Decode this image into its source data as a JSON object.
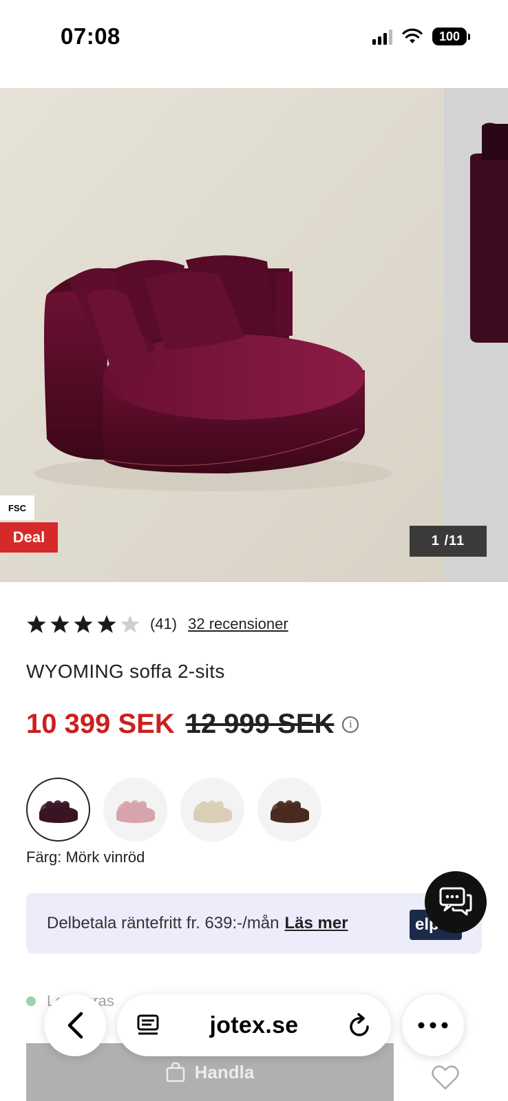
{
  "status_bar": {
    "time": "07:08",
    "battery": "100"
  },
  "gallery": {
    "badge_fsc": "FSC",
    "badge_deal": "Deal",
    "counter": "1 /11"
  },
  "product": {
    "rating": 4,
    "rating_max": 5,
    "rating_count": "(41)",
    "reviews_link": "32 recensioner",
    "title": "WYOMING soffa 2-sits",
    "price_now": "10 399 SEK",
    "price_old": "12 999 SEK",
    "color_label": "Färg: Mörk vinröd",
    "swatches": [
      {
        "color": "#3a1424",
        "selected": true
      },
      {
        "color": "#d7a3ac",
        "selected": false
      },
      {
        "color": "#d9cfb7",
        "selected": false
      },
      {
        "color": "#4a2a1e",
        "selected": false
      }
    ]
  },
  "finance": {
    "text": "Delbetala räntefritt fr. 639:-/mån",
    "link": "Läs mer",
    "logo": "elp"
  },
  "delivery": {
    "text": "Levereras"
  },
  "buy": {
    "label": "Handla"
  },
  "browser": {
    "url": "jotex.se"
  },
  "colors": {
    "sale_red": "#cc1f1f",
    "deal_red": "#d62a2a",
    "sofa": "#6e0f33"
  }
}
